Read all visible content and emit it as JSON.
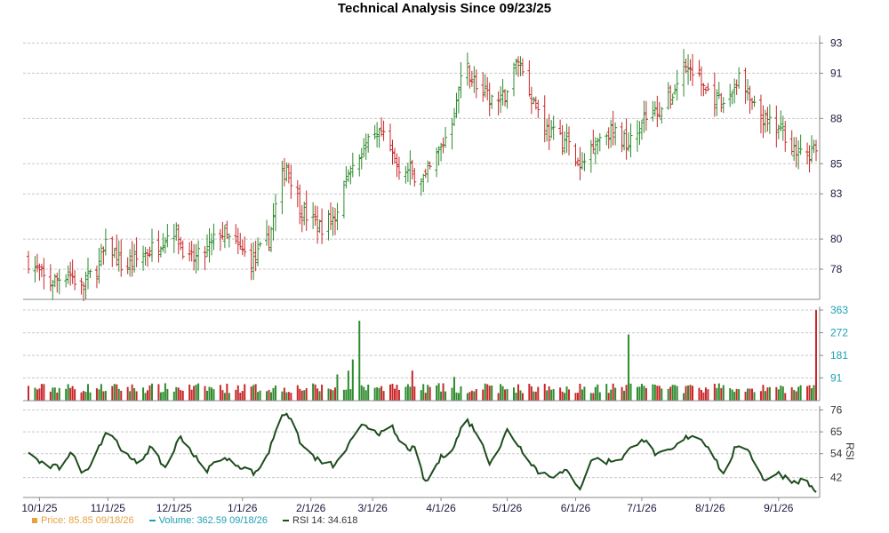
{
  "title": "Technical Analysis Since 09/23/25",
  "legend": {
    "price": "Price: 85.85  09/18/26",
    "volume": "Volume: 362.59  09/18/26",
    "rsi": "RSI 14: 34.618"
  },
  "colors": {
    "up": "#2e8b2e",
    "down": "#c8282a",
    "rsi_line": "#1e4d1e",
    "price_axis": "#1a1a40",
    "volume_axis": "#1fa0b4",
    "rsi_axis": "#333333",
    "legend_price": "#e8a040",
    "legend_volume": "#1fa0b4"
  },
  "chart_data": [
    {
      "type": "ohlc",
      "panel": "price",
      "x_range": [
        "2025-09-26",
        "2026-09-18"
      ],
      "ylim": [
        76,
        93.5
      ],
      "y_ticks": [
        78,
        80,
        83,
        85,
        88,
        91,
        93
      ],
      "x_ticks": [
        "10/1/25",
        "11/1/25",
        "12/1/25",
        "1/1/26",
        "2/1/26",
        "3/1/26",
        "4/1/26",
        "5/1/26",
        "6/1/26",
        "7/1/26",
        "8/1/26",
        "9/1/26"
      ],
      "x_tick_dates": [
        "2025-10-01",
        "2025-11-01",
        "2025-12-01",
        "2026-01-01",
        "2026-02-01",
        "2026-03-01",
        "2026-04-01",
        "2026-05-01",
        "2026-06-01",
        "2026-07-01",
        "2026-08-01",
        "2026-09-01"
      ],
      "grid": true,
      "close_points": [
        [
          "2025-09-26",
          78.6
        ],
        [
          "2025-10-05",
          77.0
        ],
        [
          "2025-10-14",
          77.8
        ],
        [
          "2025-10-20",
          76.8
        ],
        [
          "2025-10-28",
          78.3
        ],
        [
          "2025-11-01",
          79.8
        ],
        [
          "2025-11-08",
          78.0
        ],
        [
          "2025-11-15",
          78.7
        ],
        [
          "2025-11-22",
          79.5
        ],
        [
          "2025-12-01",
          80.7
        ],
        [
          "2025-12-08",
          78.5
        ],
        [
          "2025-12-15",
          79.0
        ],
        [
          "2025-12-22",
          80.5
        ],
        [
          "2025-12-29",
          79.5
        ],
        [
          "2026-01-06",
          78.5
        ],
        [
          "2026-01-13",
          80.0
        ],
        [
          "2026-01-18",
          83.5
        ],
        [
          "2026-01-21",
          85.0
        ],
        [
          "2026-01-28",
          81.8
        ],
        [
          "2026-02-05",
          80.8
        ],
        [
          "2026-02-12",
          81.5
        ],
        [
          "2026-02-18",
          84.5
        ],
        [
          "2026-02-25",
          86.0
        ],
        [
          "2026-03-05",
          86.8
        ],
        [
          "2026-03-12",
          85.0
        ],
        [
          "2026-03-18",
          84.5
        ],
        [
          "2026-03-25",
          84.0
        ],
        [
          "2026-04-01",
          86.0
        ],
        [
          "2026-04-06",
          88.0
        ],
        [
          "2026-04-12",
          91.5
        ],
        [
          "2026-04-20",
          89.5
        ],
        [
          "2026-04-28",
          89.0
        ],
        [
          "2026-05-01",
          90.0
        ],
        [
          "2026-05-06",
          92.0
        ],
        [
          "2026-05-12",
          89.5
        ],
        [
          "2026-05-20",
          87.0
        ],
        [
          "2026-05-28",
          86.5
        ],
        [
          "2026-06-03",
          84.5
        ],
        [
          "2026-06-09",
          86.5
        ],
        [
          "2026-06-16",
          87.2
        ],
        [
          "2026-06-24",
          86.5
        ],
        [
          "2026-07-01",
          88.0
        ],
        [
          "2026-07-08",
          88.5
        ],
        [
          "2026-07-14",
          89.3
        ],
        [
          "2026-07-20",
          91.5
        ],
        [
          "2026-07-25",
          91.0
        ],
        [
          "2026-08-01",
          89.5
        ],
        [
          "2026-08-07",
          88.7
        ],
        [
          "2026-08-14",
          90.8
        ],
        [
          "2026-08-21",
          88.5
        ],
        [
          "2026-08-28",
          87.5
        ],
        [
          "2026-09-04",
          87.0
        ],
        [
          "2026-09-10",
          85.5
        ],
        [
          "2026-09-18",
          85.85
        ]
      ]
    },
    {
      "type": "bar",
      "panel": "volume",
      "x_range": [
        "2025-09-26",
        "2026-09-18"
      ],
      "ylim": [
        0,
        363
      ],
      "y_ticks": [
        91,
        181,
        272,
        363
      ],
      "base_volume_range": [
        30,
        70
      ],
      "spikes": [
        [
          "2026-02-13",
          105
        ],
        [
          "2026-02-18",
          120
        ],
        [
          "2026-02-20",
          165
        ],
        [
          "2026-02-23",
          320
        ],
        [
          "2026-03-19",
          120
        ],
        [
          "2026-04-07",
          95
        ],
        [
          "2026-06-25",
          265
        ],
        [
          "2026-09-18",
          362.59
        ]
      ],
      "last_value": 362.59
    },
    {
      "type": "line",
      "panel": "rsi",
      "name": "RSI 14",
      "x_range": [
        "2025-09-26",
        "2026-09-18"
      ],
      "ylim": [
        32,
        78
      ],
      "y_ticks": [
        42,
        54,
        65,
        76
      ],
      "ylabel": "RSI",
      "values": [
        [
          "2025-09-26",
          54.6
        ],
        [
          "2025-10-03",
          48
        ],
        [
          "2025-10-10",
          47
        ],
        [
          "2025-10-15",
          55
        ],
        [
          "2025-10-21",
          44
        ],
        [
          "2025-10-25",
          51
        ],
        [
          "2025-11-01",
          67
        ],
        [
          "2025-11-05",
          60
        ],
        [
          "2025-11-11",
          51
        ],
        [
          "2025-11-15",
          49
        ],
        [
          "2025-11-20",
          57
        ],
        [
          "2025-11-27",
          47
        ],
        [
          "2025-12-04",
          63
        ],
        [
          "2025-12-09",
          55
        ],
        [
          "2025-12-15",
          45
        ],
        [
          "2025-12-22",
          52
        ],
        [
          "2025-12-29",
          49
        ],
        [
          "2026-01-07",
          44
        ],
        [
          "2026-01-13",
          55
        ],
        [
          "2026-01-18",
          73
        ],
        [
          "2026-01-21",
          75
        ],
        [
          "2026-01-28",
          58
        ],
        [
          "2026-02-05",
          50
        ],
        [
          "2026-02-12",
          48
        ],
        [
          "2026-02-18",
          58
        ],
        [
          "2026-02-25",
          69
        ],
        [
          "2026-03-05",
          64
        ],
        [
          "2026-03-10",
          67
        ],
        [
          "2026-03-14",
          58
        ],
        [
          "2026-03-20",
          56
        ],
        [
          "2026-03-25",
          39
        ],
        [
          "2026-04-01",
          52
        ],
        [
          "2026-04-07",
          58
        ],
        [
          "2026-04-12",
          72
        ],
        [
          "2026-04-17",
          65
        ],
        [
          "2026-04-23",
          50
        ],
        [
          "2026-04-28",
          58
        ],
        [
          "2026-05-01",
          66
        ],
        [
          "2026-05-07",
          57
        ],
        [
          "2026-05-15",
          45
        ],
        [
          "2026-05-22",
          43
        ],
        [
          "2026-05-28",
          45
        ],
        [
          "2026-06-03",
          37
        ],
        [
          "2026-06-09",
          52
        ],
        [
          "2026-06-15",
          50
        ],
        [
          "2026-06-22",
          52
        ],
        [
          "2026-07-01",
          62
        ],
        [
          "2026-07-08",
          53
        ],
        [
          "2026-07-15",
          56
        ],
        [
          "2026-07-21",
          62
        ],
        [
          "2026-07-25",
          64
        ],
        [
          "2026-08-01",
          57
        ],
        [
          "2026-08-07",
          43
        ],
        [
          "2026-08-12",
          56
        ],
        [
          "2026-08-18",
          57
        ],
        [
          "2026-08-25",
          41
        ],
        [
          "2026-09-01",
          44
        ],
        [
          "2026-09-08",
          40
        ],
        [
          "2026-09-13",
          41
        ],
        [
          "2026-09-18",
          34.618
        ]
      ]
    }
  ]
}
